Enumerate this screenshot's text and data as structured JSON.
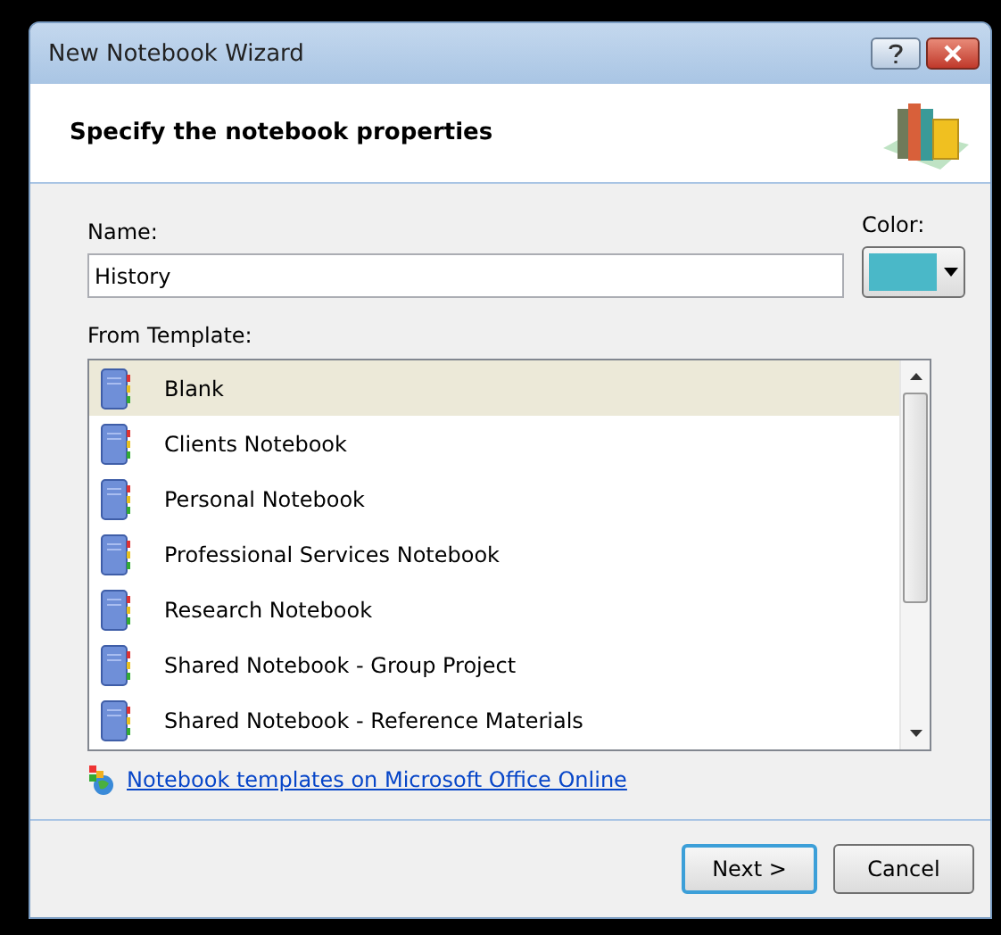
{
  "window": {
    "title": "New Notebook Wizard"
  },
  "header": {
    "title": "Specify the notebook properties"
  },
  "name_field": {
    "label": "Name:",
    "value": "History"
  },
  "color_field": {
    "label": "Color:",
    "color": "#4ab8c8"
  },
  "templates": {
    "label": "From Template:",
    "items": [
      {
        "name": "Blank",
        "selected": true
      },
      {
        "name": "Clients Notebook",
        "selected": false
      },
      {
        "name": "Personal Notebook",
        "selected": false
      },
      {
        "name": "Professional Services Notebook",
        "selected": false
      },
      {
        "name": "Research Notebook",
        "selected": false
      },
      {
        "name": "Shared Notebook - Group Project",
        "selected": false
      },
      {
        "name": "Shared Notebook - Reference Materials",
        "selected": false
      }
    ]
  },
  "link": "Notebook templates on Microsoft Office Online",
  "buttons": [
    {
      "label": "Next >",
      "kind": "default"
    },
    {
      "label": "Cancel",
      "kind": "normal"
    }
  ]
}
